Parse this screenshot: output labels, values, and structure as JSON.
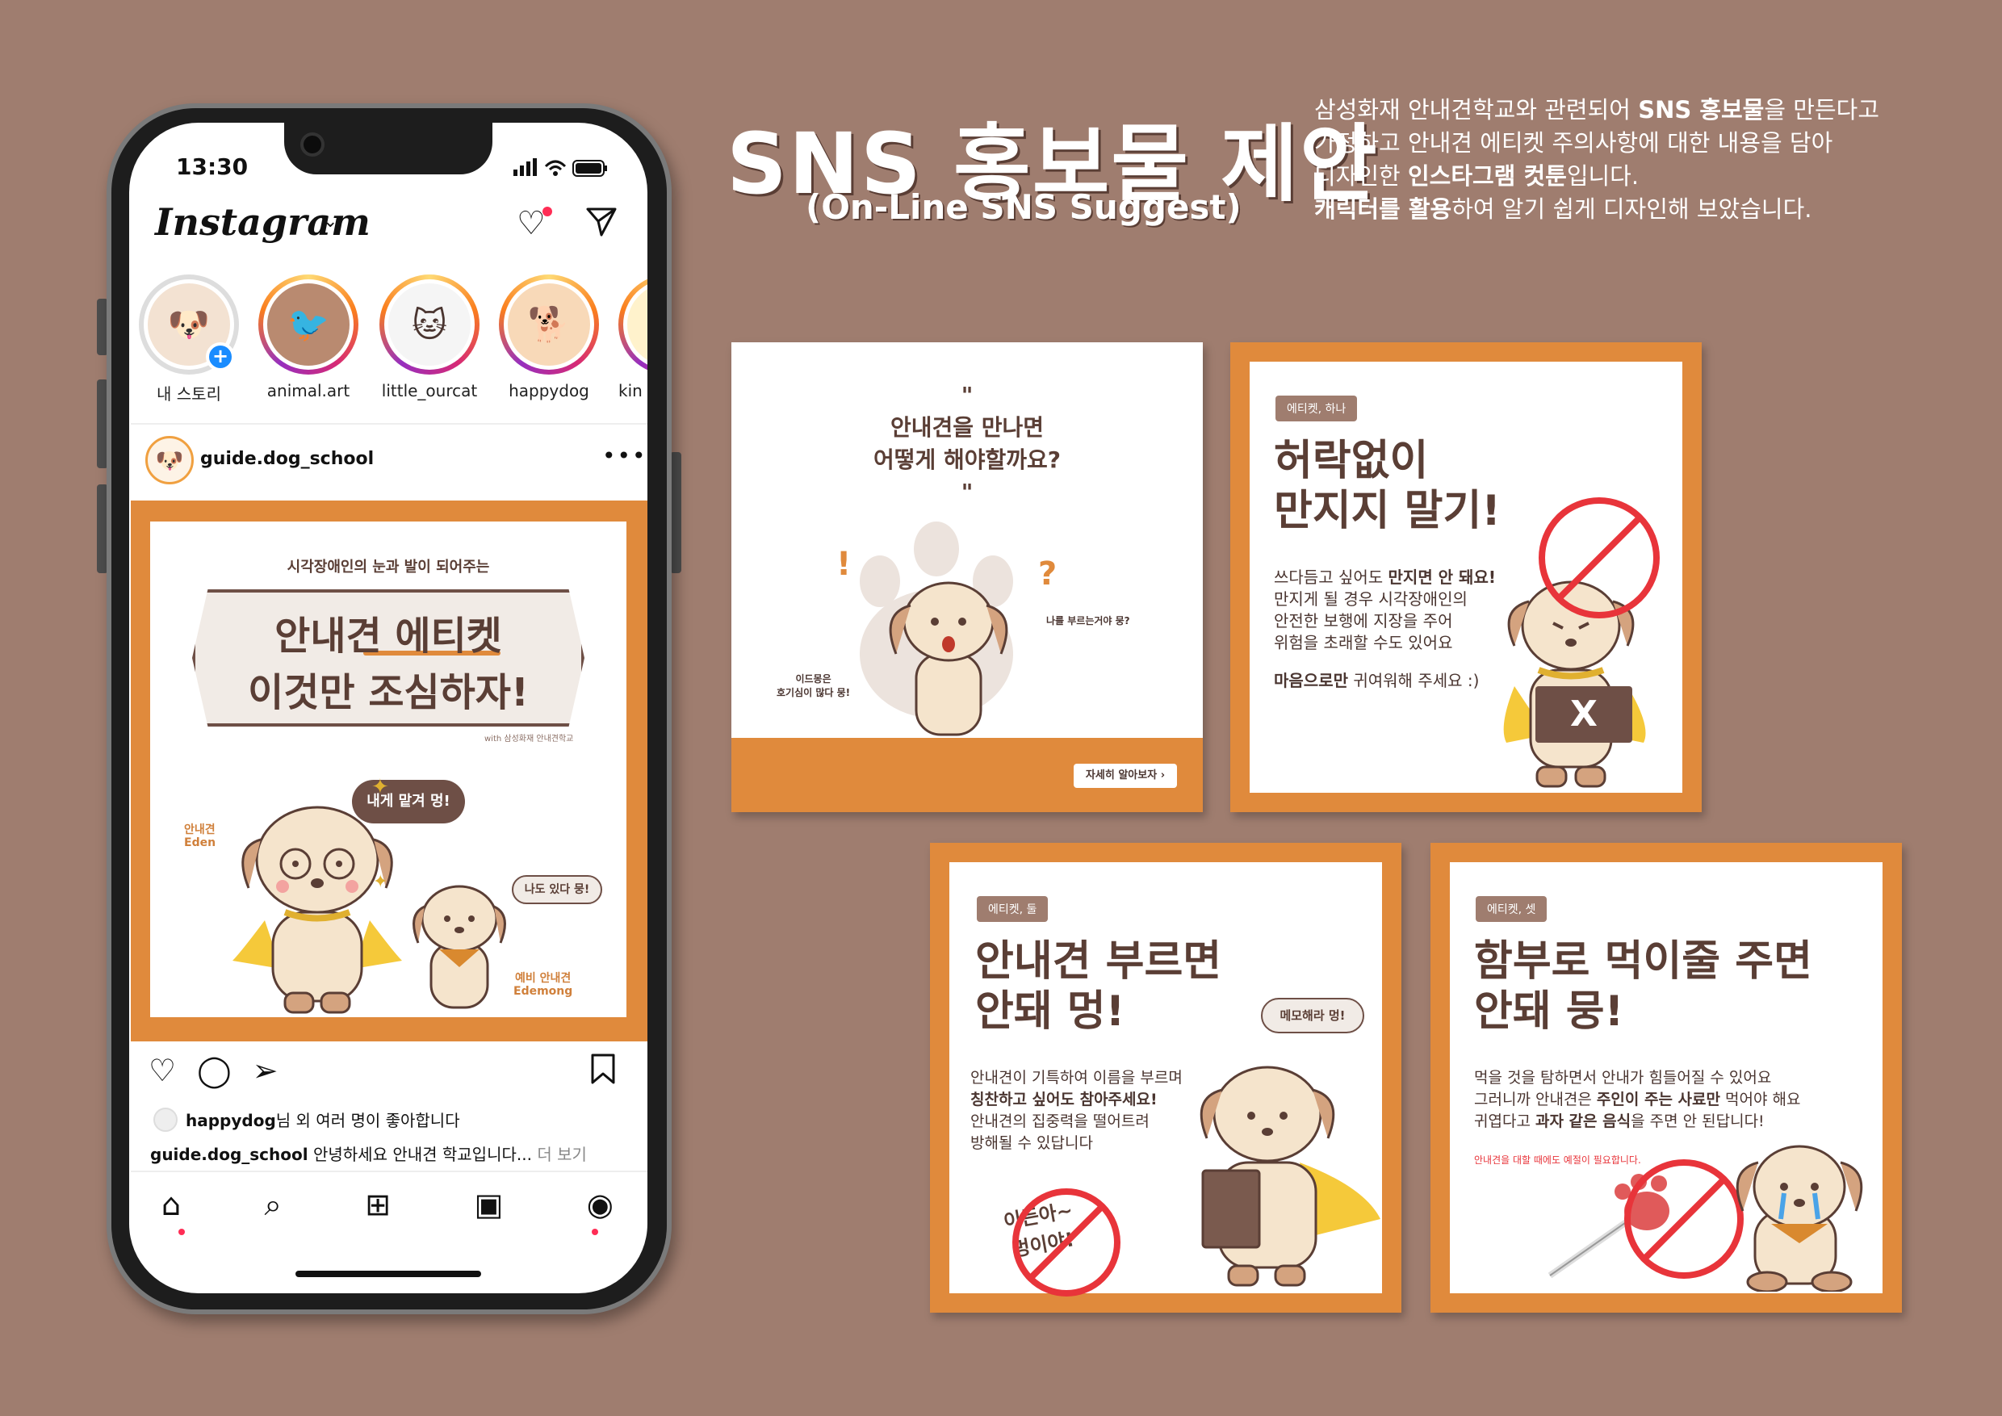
{
  "header": {
    "title": "SNS 홍보물 제안",
    "subtitle": "(On-Line SNS Suggest)",
    "desc_line1_a": "삼성화재 안내견학교와 관련되어 ",
    "desc_line1_b": "SNS 홍보물",
    "desc_line1_c": "을 만든다고",
    "desc_line2": "가정하고 안내견 에티켓 주의사항에 대한 내용을 담아",
    "desc_line3_a": "디자인한 ",
    "desc_line3_b": "인스타그램 컷툰",
    "desc_line3_c": "입니다.",
    "desc_line4_a": "캐릭터를 활용",
    "desc_line4_b": "하여 알기 쉽게 디자인해 보았습니다."
  },
  "phone": {
    "time": "13:30",
    "app_name": "Instagram",
    "stories": [
      {
        "label": "내 스토리"
      },
      {
        "label": "animal.art"
      },
      {
        "label": "little_ourcat"
      },
      {
        "label": "happydog"
      },
      {
        "label": "kin"
      }
    ],
    "post_user": "guide.dog_school",
    "post": {
      "top_text": "시각장애인의 눈과 발이 되어주는",
      "title_1": "안내견 에티켓",
      "title_2": "이것만 조심하자!",
      "credit": "with 삼성화재 안내견학교",
      "bubble_1": "내게 맡겨 멍!",
      "bubble_2": "나도 있다 뭉!",
      "char_1_ko": "안내견",
      "char_1_en": "Eden",
      "char_2_ko": "예비 안내견",
      "char_2_en": "Edemong"
    },
    "likes_user": "happydog",
    "likes_text": "님 외 여러 명이 좋아합니다",
    "caption_user": "guide.dog_school",
    "caption_text": " 안녕하세요 안내견 학교입니다...",
    "caption_more": " 더 보기"
  },
  "cards": {
    "c1": {
      "quote_open": "\"",
      "q1": "안내견을 만나면",
      "q2": "어떻게 해야할까요?",
      "quote_close": "\"",
      "left_note_1": "이드몽은",
      "left_note_2": "호기심이 많다 뭉!",
      "right_note": "나를 부르는거야 뭉?",
      "button": "자세히 알아보자"
    },
    "c2": {
      "tag": "에티켓, 하나",
      "h1": "허락없이",
      "h2": "만지지 말기!",
      "b1_a": "쓰다듬고 싶어도 ",
      "b1_b": "만지면 안 돼요!",
      "b2": "만지게 될 경우 시각장애인의",
      "b3": "안전한 보행에 지장을 주어",
      "b4": "위험을 초래할 수도 있어요",
      "b5_a": "마음으로만",
      "b5_b": " 귀여워해 주세요 :)",
      "sign": "X"
    },
    "c3": {
      "tag": "에티켓, 둘",
      "h1": "안내견 부르면",
      "h2": "안돼 멍!",
      "bubble": "메모해라 멍!",
      "b1": "안내견이 기특하여 이름을 부르며",
      "b2": "칭찬하고 싶어도 참아주세요!",
      "b3": "안내견의 집중력을 떨어트려",
      "b4": "방해될 수 있답니다",
      "stamp_1": "이든아~",
      "stamp_2": "멍이야!"
    },
    "c4": {
      "tag": "에티켓, 셋",
      "h1": "함부로 먹이줄 주면",
      "h2": "안돼 뭉!",
      "b1": "먹을 것을 탐하면서 안내가 힘들어질 수 있어요",
      "b2_a": "그러니까 안내견은 ",
      "b2_b": "주인이 주는 사료만",
      "b2_c": " 먹어야 해요",
      "b3_a": "귀엽다고 ",
      "b3_b": "과자 같은 음식",
      "b3_c": "을 주면 안 된답니다!",
      "note": "안내견을 대할 때에도 예절이 필요합니다."
    }
  }
}
